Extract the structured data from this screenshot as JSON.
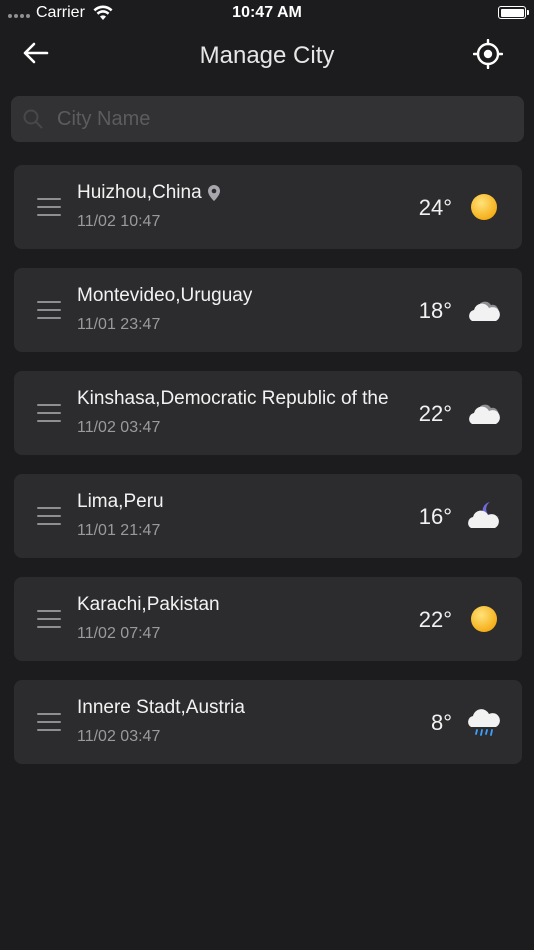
{
  "status_bar": {
    "carrier": "Carrier",
    "time": "10:47 AM"
  },
  "header": {
    "title": "Manage City"
  },
  "search": {
    "placeholder": "City Name",
    "value": ""
  },
  "cities": [
    {
      "name": "Huizhou,China",
      "time": "11/02 10:47",
      "temp": "24°",
      "weather": "sunny-icon",
      "current_location": true
    },
    {
      "name": "Montevideo,Uruguay",
      "time": "11/01 23:47",
      "temp": "18°",
      "weather": "cloudy-icon",
      "current_location": false
    },
    {
      "name": "Kinshasa,Democratic Republic of the",
      "time": "11/02 03:47",
      "temp": "22°",
      "weather": "cloudy-icon",
      "current_location": false
    },
    {
      "name": "Lima,Peru",
      "time": "11/01 21:47",
      "temp": "16°",
      "weather": "cloudy-night-icon",
      "current_location": false
    },
    {
      "name": "Karachi,Pakistan",
      "time": "11/02 07:47",
      "temp": "22°",
      "weather": "sunny-icon",
      "current_location": false
    },
    {
      "name": "Innere Stadt,Austria",
      "time": "11/02 03:47",
      "temp": "8°",
      "weather": "rain-icon",
      "current_location": false
    }
  ],
  "colors": {
    "background": "#1c1c1e",
    "card": "#2c2c2e",
    "search_bg": "#323234",
    "sun": "#f7b21c"
  }
}
